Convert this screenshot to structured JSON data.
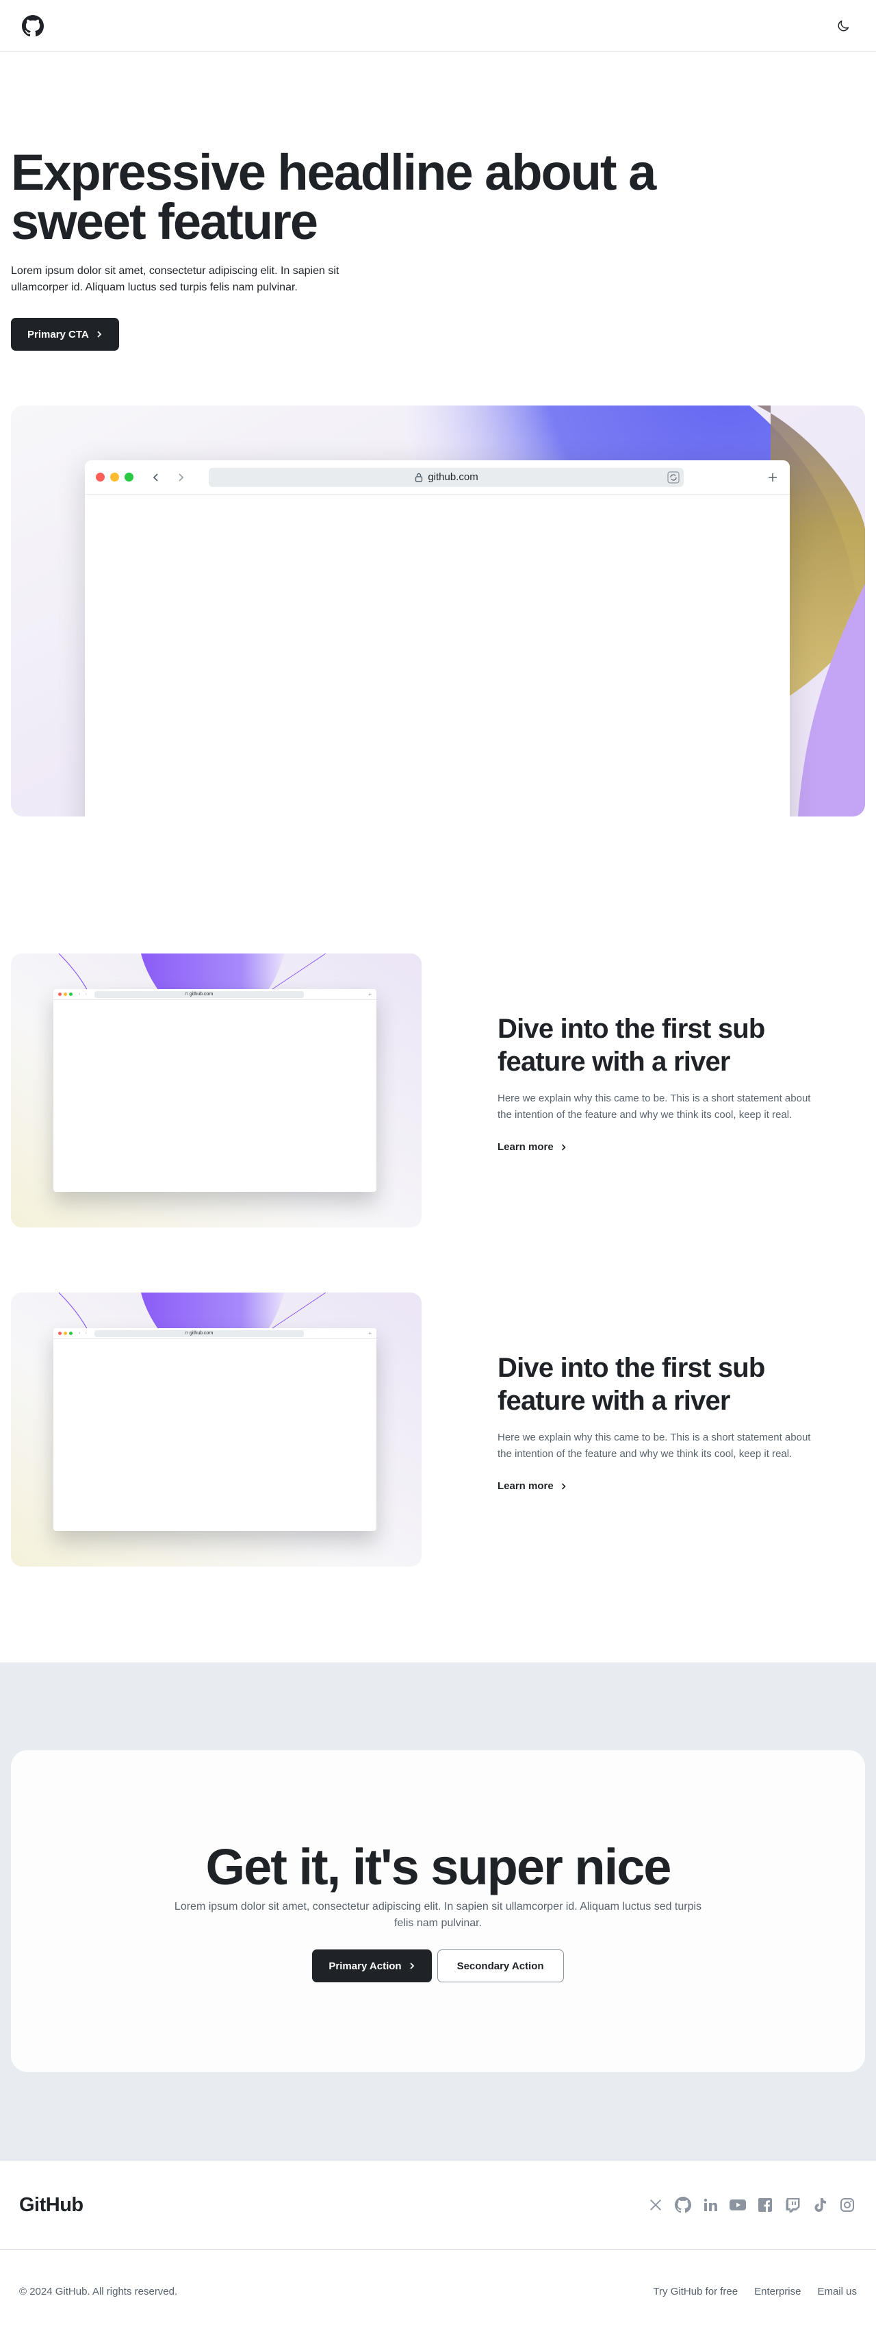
{
  "header": {
    "logo_icon": "github-mark-icon",
    "theme_toggle_icon": "moon-icon"
  },
  "hero": {
    "headline": "Expressive headline about a sweet feature",
    "body": "Lorem ipsum dolor sit amet, consectetur adipiscing elit. In sapien sit ullamcorper id. Aliquam luctus sed turpis felis nam pulvinar.",
    "cta_label": "Primary CTA",
    "browser_url": "github.com"
  },
  "rivers": [
    {
      "title": "Dive into the first sub feature with a river",
      "body": "Here we explain why this came to be. This is a short statement about the intention of the feature and why we think its cool, keep it real.",
      "link_label": "Learn more",
      "browser_url": "github.com"
    },
    {
      "title": "Dive into the first sub feature with a river",
      "body": "Here we explain why this came to be. This is a short statement about the intention of the feature and why we think its cool, keep it real.",
      "link_label": "Learn more",
      "browser_url": "github.com"
    }
  ],
  "cta": {
    "headline": "Get it, it's super nice",
    "body": "Lorem ipsum dolor sit amet, consectetur adipiscing elit. In sapien sit ullamcorper id. Aliquam luctus sed turpis felis nam pulvinar.",
    "primary_label": "Primary Action",
    "secondary_label": "Secondary Action"
  },
  "footer": {
    "brand": "GitHub",
    "social_icons": [
      "x-icon",
      "github-icon",
      "linkedin-icon",
      "youtube-icon",
      "facebook-icon",
      "twitch-icon",
      "tiktok-icon",
      "instagram-icon"
    ],
    "copyright": "© 2024 GitHub. All rights reserved.",
    "links": [
      "Try GitHub for free",
      "Enterprise",
      "Email us"
    ]
  },
  "colors": {
    "text": "#1f2328",
    "muted": "#59636e",
    "accent_purple": "#6366f1",
    "accent_gold": "#b8a04a",
    "band_bg": "#e8ebf0"
  }
}
